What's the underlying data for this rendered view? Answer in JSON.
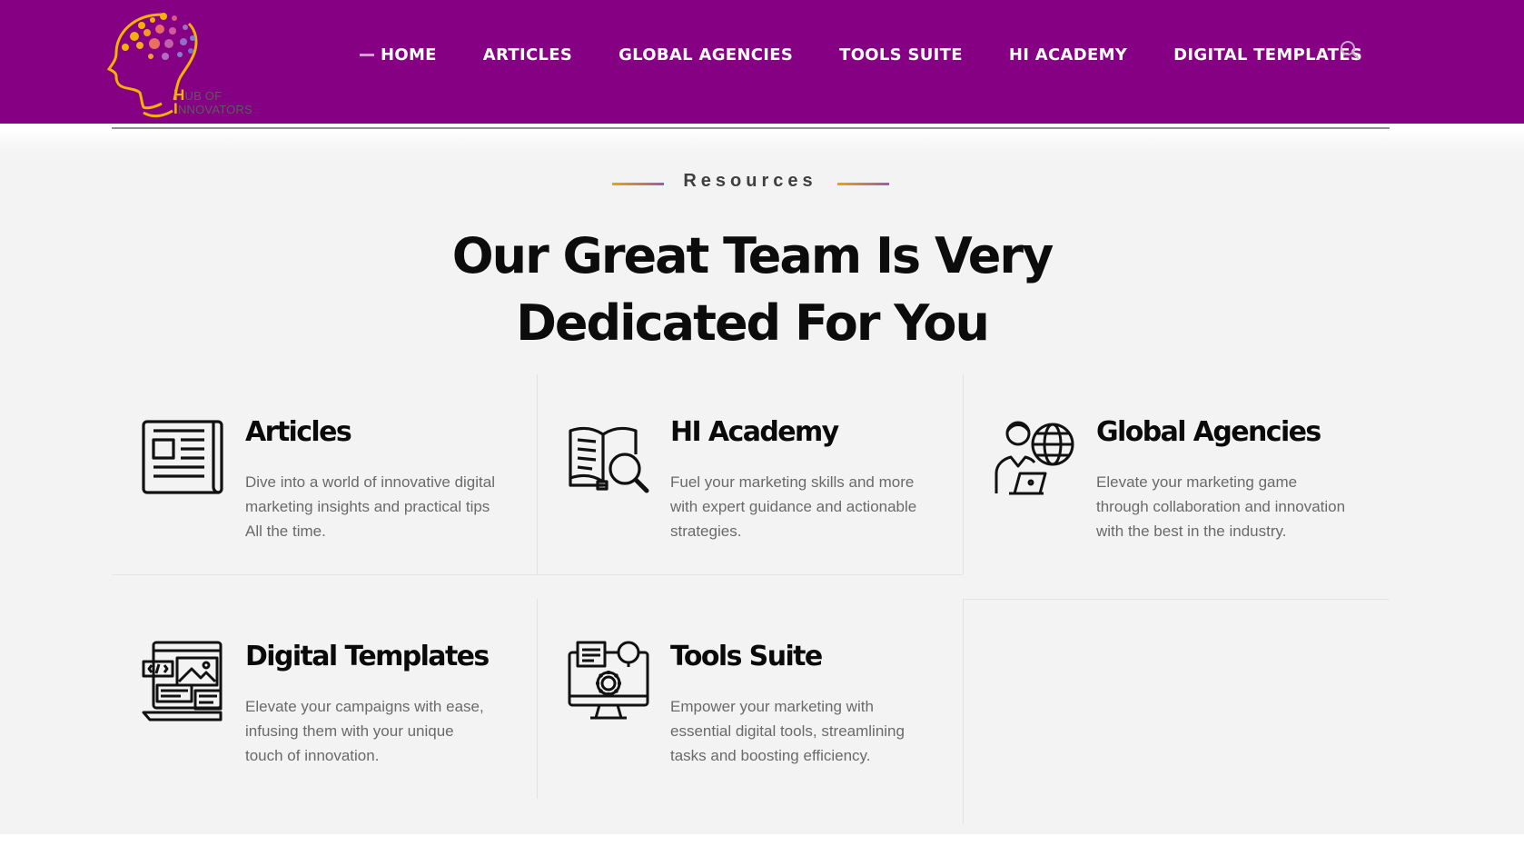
{
  "brand": {
    "logo_first_letter_1": "H",
    "logo_rest_1": "UB OF",
    "logo_first_letter_2": "I",
    "logo_rest_2": "NNOVATORS",
    "logo_alt": "Hub of Innovators logo",
    "primary_color": "#850082",
    "accent_color": "#f2b300"
  },
  "nav": {
    "items": [
      {
        "label": "HOME",
        "active": true
      },
      {
        "label": "ARTICLES"
      },
      {
        "label": "GLOBAL AGENCIES"
      },
      {
        "label": "TOOLS SUITE"
      },
      {
        "label": "HI ACADEMY"
      },
      {
        "label": "DIGITAL TEMPLATES"
      }
    ],
    "search_icon": "search-icon"
  },
  "section": {
    "eyebrow": "Resources",
    "headline_line1": "Our Great Team Is Very",
    "headline_line2": "Dedicated For You"
  },
  "cards": [
    {
      "icon": "newspaper-icon",
      "title": "Articles",
      "desc": "Dive into a world of innovative digital marketing insights and practical tips All the time."
    },
    {
      "icon": "book-search-icon",
      "title": "HI Academy",
      "desc": "Fuel your marketing skills and more with expert guidance and actionable strategies."
    },
    {
      "icon": "agent-globe-icon",
      "title": "Global Agencies",
      "desc": "Elevate your marketing game through collaboration and innovation with the best in the industry."
    },
    {
      "icon": "templates-icon",
      "title": "Digital Templates",
      "desc": "Elevate your campaigns with ease, infusing them with your unique touch of innovation."
    },
    {
      "icon": "monitor-gear-icon",
      "title": "Tools Suite",
      "desc": "Empower your marketing with essential digital tools, streamlining tasks and boosting efficiency."
    }
  ]
}
